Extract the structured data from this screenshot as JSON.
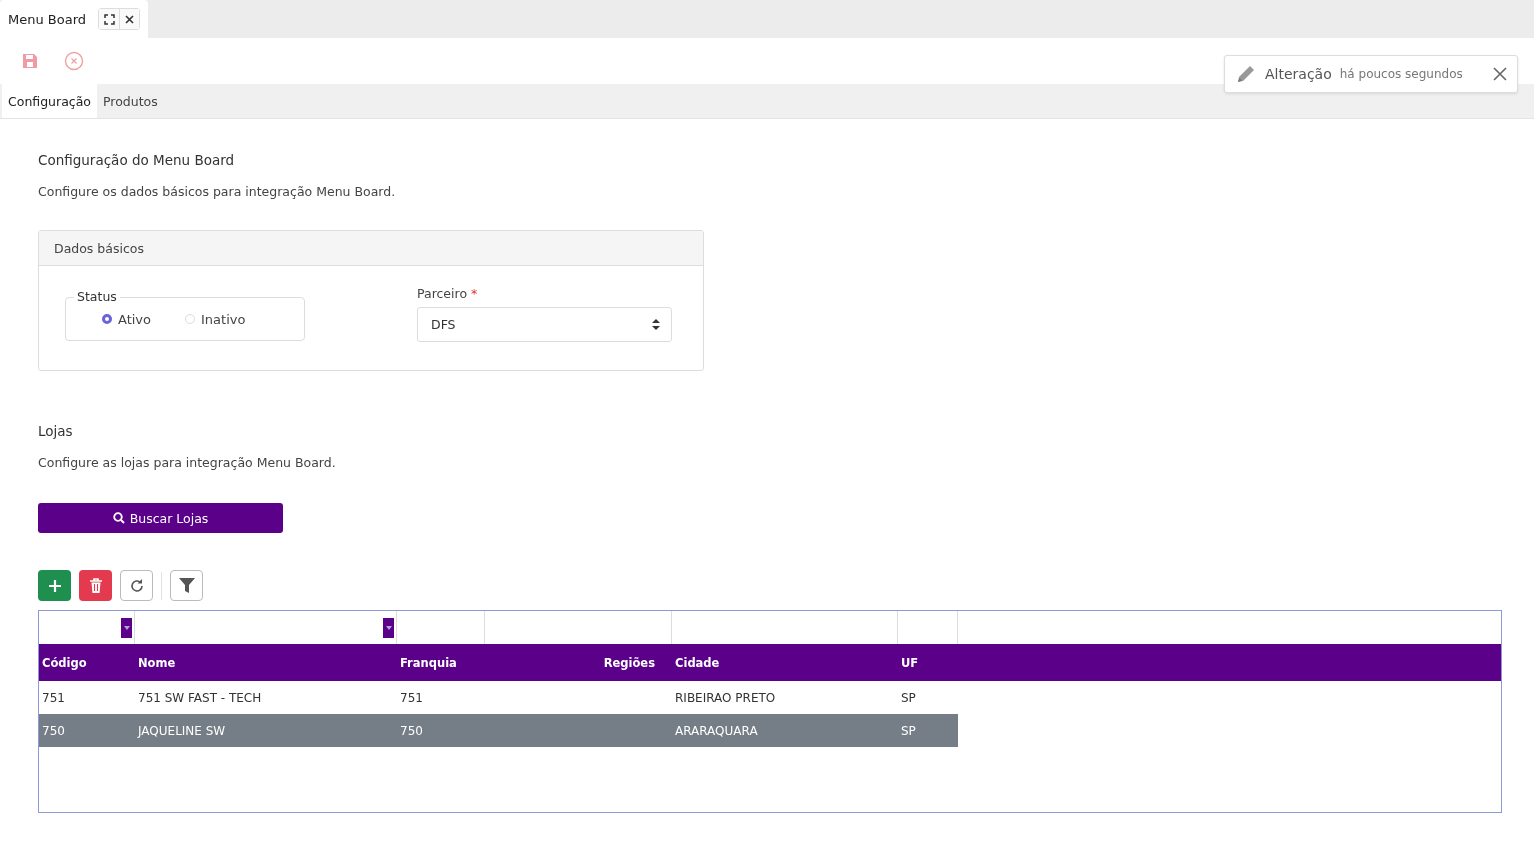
{
  "window": {
    "title": "Menu Board"
  },
  "tabs": [
    {
      "label": "Configuração",
      "selected": true
    },
    {
      "label": "Produtos",
      "selected": false
    }
  ],
  "notification": {
    "title": "Alteração",
    "time": "há poucos segundos"
  },
  "config": {
    "title": "Configuração do Menu Board",
    "description": "Configure os dados básicos para integração Menu Board."
  },
  "basic_data": {
    "title": "Dados básicos",
    "status": {
      "legend": "Status",
      "options": [
        {
          "label": "Ativo",
          "selected": true
        },
        {
          "label": "Inativo",
          "selected": false
        }
      ]
    },
    "partner": {
      "label": "Parceiro",
      "required": "*",
      "value": "DFS"
    }
  },
  "stores": {
    "title": "Lojas",
    "description": "Configure as lojas para integração Menu Board.",
    "search_button": "Buscar Lojas"
  },
  "table": {
    "columns": [
      {
        "label": "Código",
        "filter_dropdown": true
      },
      {
        "label": "Nome",
        "filter_dropdown": true
      },
      {
        "label": "Franquia",
        "filter_dropdown": false
      },
      {
        "label": "Regiões",
        "filter_dropdown": false
      },
      {
        "label": "Cidade",
        "filter_dropdown": false
      },
      {
        "label": "UF",
        "filter_dropdown": false
      }
    ],
    "rows": [
      {
        "selected": false,
        "cells": [
          "751",
          "751 SW FAST - TECH",
          "751",
          "",
          "RIBEIRAO PRETO",
          "SP"
        ]
      },
      {
        "selected": true,
        "cells": [
          "750",
          "JAQUELINE SW",
          "750",
          "",
          "ARARAQUARA",
          "SP"
        ]
      }
    ]
  }
}
